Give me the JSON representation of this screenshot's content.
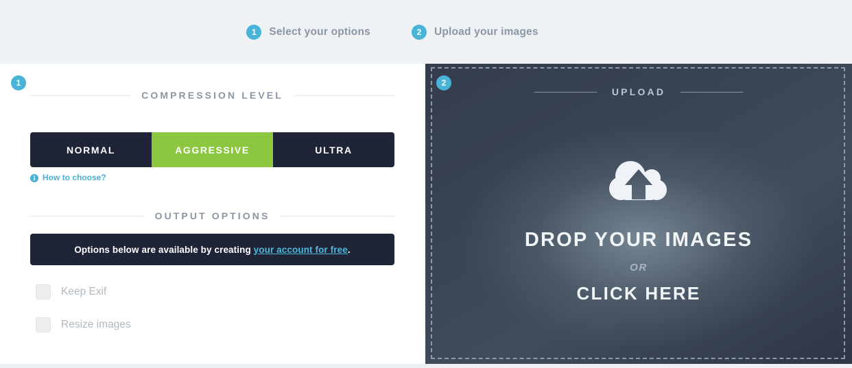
{
  "stepper": {
    "steps": [
      {
        "number": "1",
        "label": "Select your options"
      },
      {
        "number": "2",
        "label": "Upload your images"
      }
    ]
  },
  "left_panel": {
    "badge": "1",
    "compression": {
      "section_title": "COMPRESSION LEVEL",
      "options": [
        {
          "label": "NORMAL",
          "selected": false
        },
        {
          "label": "AGGRESSIVE",
          "selected": true
        },
        {
          "label": "ULTRA",
          "selected": false
        }
      ],
      "help_link": "How to choose?",
      "help_icon": "info-circle-icon"
    },
    "output": {
      "section_title": "OUTPUT OPTIONS",
      "notice_prefix": "Options below are available by creating ",
      "notice_link": "your account for free",
      "notice_suffix": ".",
      "checkboxes": [
        {
          "label": "Keep Exif",
          "checked": false
        },
        {
          "label": "Resize images",
          "checked": false
        }
      ]
    }
  },
  "right_panel": {
    "badge": "2",
    "upload_title": "UPLOAD",
    "cloud_icon": "cloud-upload-icon",
    "drop_main": "DROP YOUR IMAGES",
    "drop_or": "OR",
    "drop_click": "CLICK HERE"
  },
  "colors": {
    "accent_blue": "#47b4d8",
    "accent_green": "#8dc63f",
    "dark_navy": "#1f2437",
    "header_bg": "#eef2f5",
    "muted_text": "#8a96a3",
    "link_blue": "#4fb8dd"
  }
}
